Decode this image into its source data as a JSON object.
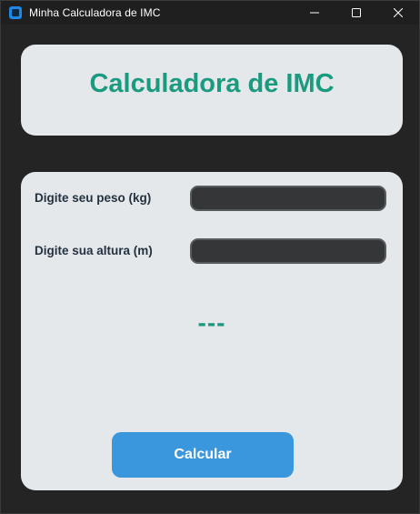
{
  "window": {
    "title": "Minha Calculadora de IMC",
    "controls": [
      "minimize-icon",
      "maximize-icon",
      "close-icon"
    ]
  },
  "header": {
    "title": "Calculadora de IMC"
  },
  "form": {
    "weight_label": "Digite seu peso (kg)",
    "weight_value": "",
    "height_label": "Digite sua altura (m)",
    "height_value": "",
    "result": "---",
    "calculate_label": "Calcular"
  },
  "colors": {
    "accent": "#1a9b80",
    "button": "#3b97dd",
    "card": "#e4e8ea",
    "background": "#242424",
    "input_bg": "#343638"
  }
}
